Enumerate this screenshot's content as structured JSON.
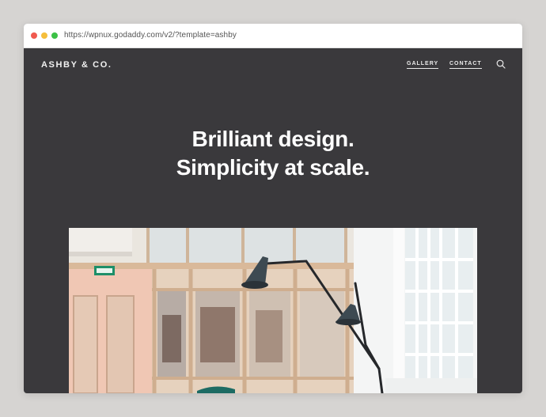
{
  "browser": {
    "url": "https://wpnux.godaddy.com/v2/?template=ashby"
  },
  "site": {
    "logo": "ASHBY & CO.",
    "nav": [
      {
        "label": "GALLERY"
      },
      {
        "label": "CONTACT"
      }
    ],
    "search_icon": "search-icon"
  },
  "hero": {
    "line1": "Brilliant design.",
    "line2": "Simplicity at scale."
  },
  "colors": {
    "page_background": "#3a393c",
    "outer_background": "#d6d4d2",
    "text": "#ffffff"
  }
}
